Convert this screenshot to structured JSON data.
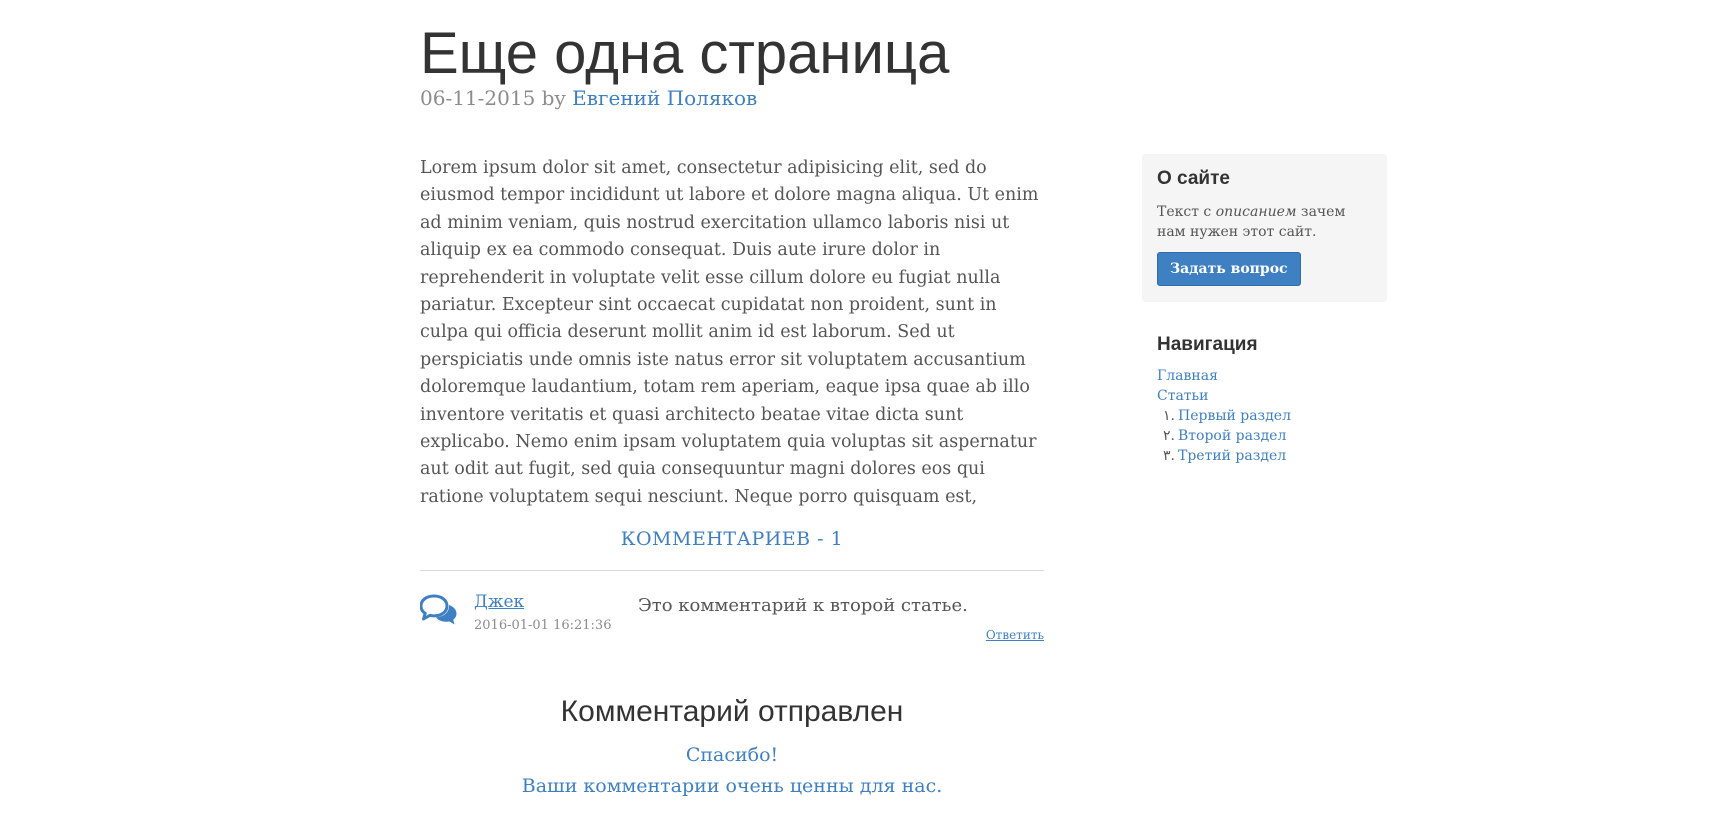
{
  "post": {
    "title": "Еще одна страница",
    "date": "06-11-2015",
    "by": "by",
    "author": "Евгений Поляков",
    "body": "Lorem ipsum dolor sit amet, consectetur adipisicing elit, sed do eiusmod tempor incididunt ut labore et dolore magna aliqua. Ut enim ad minim veniam, quis nostrud exercitation ullamco laboris nisi ut aliquip ex ea commodo consequat. Duis aute irure dolor in reprehenderit in voluptate velit esse cillum dolore eu fugiat nulla pariatur. Excepteur sint occaecat cupidatat non proident, sunt in culpa qui officia deserunt mollit anim id est laborum. Sed ut perspiciatis unde omnis iste natus error sit voluptatem accusantium doloremque laudantium, totam rem aperiam, eaque ipsa quae ab illo inventore veritatis et quasi architecto beatae vitae dicta sunt explicabo. Nemo enim ipsam voluptatem quia voluptas sit aspernatur aut odit aut fugit, sed quia consequuntur magni dolores eos qui ratione voluptatem sequi nesciunt. Neque porro quisquam est,"
  },
  "comments": {
    "header": "КОММЕНТАРИЕВ - 1",
    "items": [
      {
        "author": "Джек",
        "date": "2016-01-01 16:21:36",
        "text": "Это комментарий к второй статье.",
        "reply_label": "Ответить"
      }
    ]
  },
  "confirmation": {
    "title": "Комментарий отправлен",
    "line1": "Спасибо!",
    "line2": "Ваши комментарии очень ценны для нас."
  },
  "sidebar": {
    "about": {
      "title": "О сайте",
      "text_before": "Текст с ",
      "text_em": "описанием",
      "text_after": " зачем нам нужен этот сайт.",
      "button_label": "Задать вопрос"
    },
    "nav": {
      "title": "Навигация",
      "items": [
        {
          "label": "Главная"
        },
        {
          "label": "Статьи"
        }
      ],
      "subitems": [
        {
          "num": "١.",
          "label": "Первый раздел"
        },
        {
          "num": "٢.",
          "label": "Второй раздел"
        },
        {
          "num": "٣.",
          "label": "Третий раздел"
        }
      ]
    }
  },
  "colors": {
    "link": "#3f80c2",
    "text": "#555555",
    "heading": "#333333",
    "muted": "#8c8c8c",
    "sidebar_bg": "#f5f5f5"
  },
  "icons": {
    "comment": "comments-icon"
  }
}
